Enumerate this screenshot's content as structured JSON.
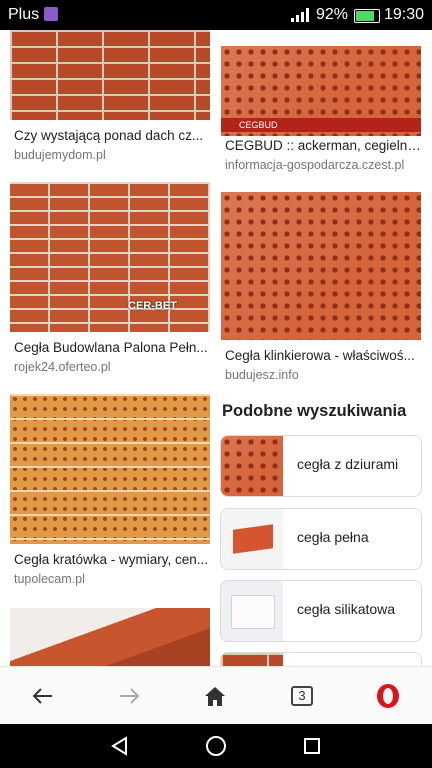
{
  "status_bar": {
    "carrier": "Plus",
    "signal_icon": "signal-icon",
    "battery_percent": "92%",
    "time": "19:30"
  },
  "results": [
    {
      "title": "Czy wystającą ponad dach cz...",
      "source": "budujemydom.pl"
    },
    {
      "title": "CEGBUD :: ackerman, cegielni...",
      "source": "informacja-gospodarcza.czest.pl"
    },
    {
      "title": "Cegła Budowlana Palona Pełn...",
      "source": "rojek24.oferteo.pl"
    },
    {
      "title": "Cegła klinkierowa - właściwoś...",
      "source": "budujesz.info"
    },
    {
      "title": "Cegła kratówka - wymiary, cen...",
      "source": "tupolecam.pl"
    }
  ],
  "image_overlays": {
    "cegbud_banner": "CEGBUD",
    "cerbet_watermark": "CER-BET"
  },
  "similar": {
    "title": "Podobne wyszukiwania",
    "items": [
      {
        "label": "cegła z dziurami"
      },
      {
        "label": "cegła pełna"
      },
      {
        "label": "cegła silikatowa"
      }
    ]
  },
  "browser_nav": {
    "tab_count": "3"
  }
}
